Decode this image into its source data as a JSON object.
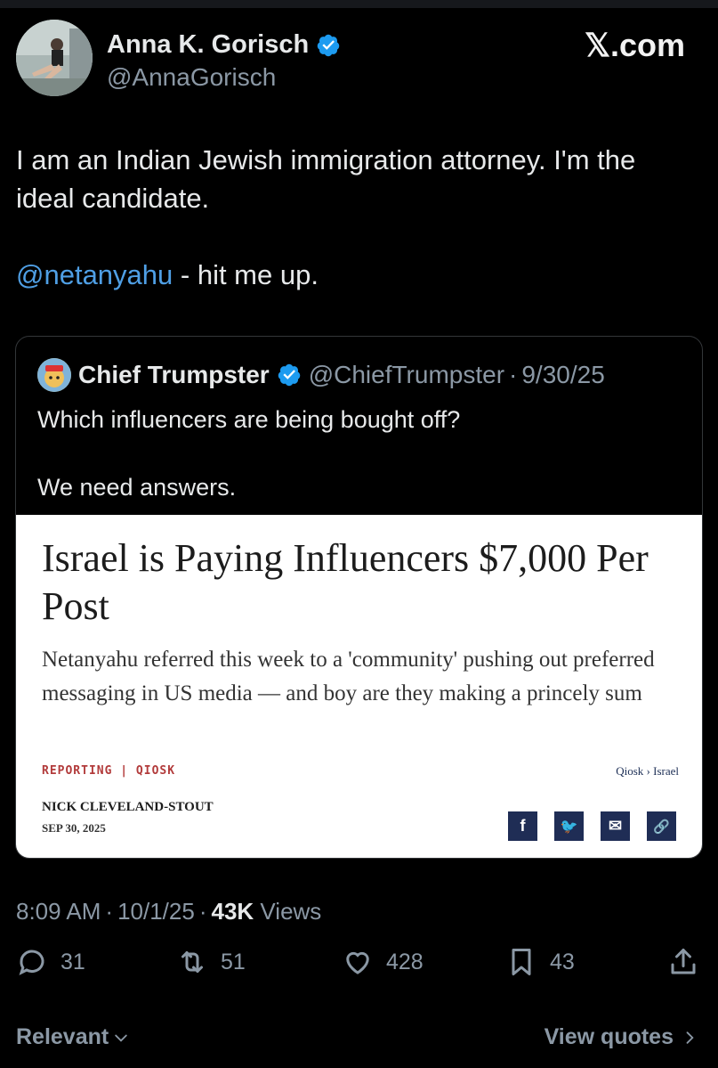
{
  "header": {
    "name": "Anna K. Gorisch",
    "handle": "@AnnaGorisch",
    "brand": "𝕏.com"
  },
  "tweet": {
    "line1": "I am an Indian Jewish immigration attorney. I'm the ideal candidate.",
    "mention": "@netanyahu",
    "mention_rest": " - hit me up."
  },
  "quote": {
    "name": "Chief Trumpster",
    "handle": "@ChiefTrumpster",
    "dot": "·",
    "date": "9/30/25",
    "text1": "Which influencers are being bought off?",
    "text2": "We need answers.",
    "article": {
      "title": "Israel is Paying Influencers $7,000 Per Post",
      "subtitle": "Netanyahu referred this week to a 'community' pushing out preferred messaging in US media — and boy are they making a princely sum",
      "section": "REPORTING | QIOSK",
      "breadcrumb": "Qiosk › Israel",
      "author": "NICK CLEVELAND-STOUT",
      "date": "SEP 30, 2025",
      "share_facebook": "f",
      "share_twitter": "🐦",
      "share_email": "✉",
      "share_link": "🔗"
    }
  },
  "meta": {
    "time": "8:09 AM",
    "dot": "·",
    "date": "10/1/25",
    "views_count": "43K",
    "views_label": " Views"
  },
  "actions": {
    "replies": "31",
    "reposts": "51",
    "likes": "428",
    "bookmarks": "43"
  },
  "footer": {
    "relevant": "Relevant",
    "view_quotes": "View quotes"
  },
  "colors": {
    "background": "#000000",
    "text": "#e7e9ea",
    "secondary": "#8b98a5",
    "link": "#4f9fe5",
    "verified": "#1d9bf0"
  }
}
